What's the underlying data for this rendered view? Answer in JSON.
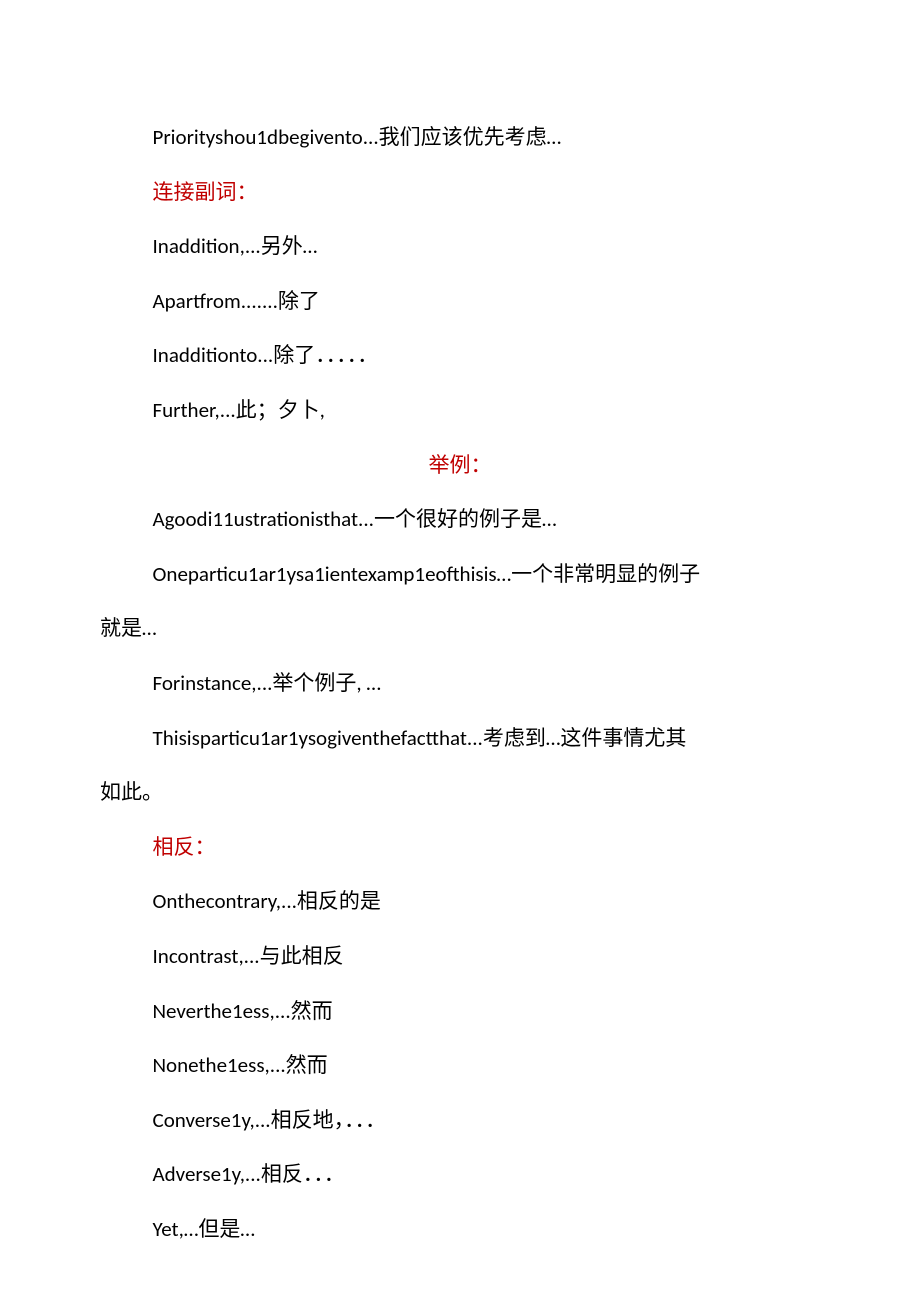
{
  "lines": [
    {
      "text": "Priorityshou1dbegivento...我们应该优先考虑…",
      "red": false,
      "center": false,
      "indent": true
    },
    {
      "text": "连接副词：",
      "red": true,
      "center": false,
      "indent": true
    },
    {
      "text": "Inaddition,...另外…",
      "red": false,
      "center": false,
      "indent": true
    },
    {
      "text": "Apartfrom.......除了",
      "red": false,
      "center": false,
      "indent": true
    },
    {
      "text": "Inadditionto...除了．．．．．",
      "red": false,
      "center": false,
      "indent": true
    },
    {
      "text": "Further,...此；夕卜,",
      "red": false,
      "center": false,
      "indent": true
    },
    {
      "text": "举例：",
      "red": true,
      "center": true,
      "indent": false
    },
    {
      "text": "Agoodi11ustrationisthat...一个很好的例子是…",
      "red": false,
      "center": false,
      "indent": true
    },
    {
      "text": "Oneparticu1ar1ysa1ientexamp1eofthisis…一个非常明显的例子",
      "red": false,
      "center": false,
      "indent": true
    },
    {
      "text": "就是…",
      "red": false,
      "center": false,
      "indent": false
    },
    {
      "text": "Forinstance,...举个例子, …",
      "red": false,
      "center": false,
      "indent": true
    },
    {
      "text": "Thisisparticu1ar1ysogiventhefactthat...考虑到…这件事情尤其",
      "red": false,
      "center": false,
      "indent": true
    },
    {
      "text": "如此。",
      "red": false,
      "center": false,
      "indent": false
    },
    {
      "text": "相反：",
      "red": true,
      "center": false,
      "indent": true
    },
    {
      "text": "Onthecontrary,...相反的是",
      "red": false,
      "center": false,
      "indent": true
    },
    {
      "text": "Incontrast,...与此相反",
      "red": false,
      "center": false,
      "indent": true
    },
    {
      "text": "Neverthe1ess,...然而",
      "red": false,
      "center": false,
      "indent": true
    },
    {
      "text": "Nonethe1ess,...然而",
      "red": false,
      "center": false,
      "indent": true
    },
    {
      "text": "Converse1y,...相反地，．．．",
      "red": false,
      "center": false,
      "indent": true
    },
    {
      "text": "Adverse1y,...相反．．．",
      "red": false,
      "center": false,
      "indent": true
    },
    {
      "text": "Yet,…但是…",
      "red": false,
      "center": false,
      "indent": true
    }
  ]
}
